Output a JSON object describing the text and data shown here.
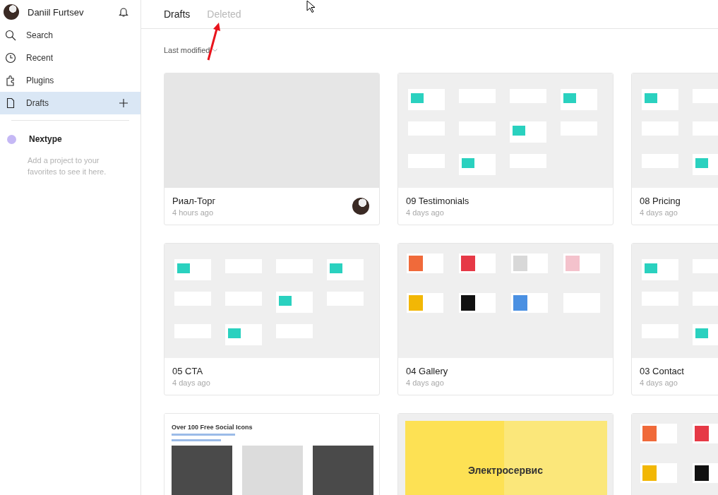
{
  "sidebar": {
    "user": {
      "name": "Daniil Furtsev"
    },
    "nav": [
      {
        "kind": "search",
        "label": "Search",
        "selected": false
      },
      {
        "kind": "recent",
        "label": "Recent",
        "selected": false
      },
      {
        "kind": "plugins",
        "label": "Plugins",
        "selected": false
      },
      {
        "kind": "drafts",
        "label": "Drafts",
        "selected": true
      }
    ],
    "teams": [
      {
        "name": "Nextype",
        "color": "#c5b8f5"
      }
    ],
    "favorites_hint": "Add a project to your favorites to see it here."
  },
  "tabs": [
    {
      "label": "Drafts",
      "selected": true
    },
    {
      "label": "Deleted",
      "selected": false
    }
  ],
  "sort": {
    "label": "Last modified"
  },
  "files": [
    {
      "kind": "blank",
      "title": "Риал-Торг",
      "modified": "4 hours ago",
      "owner_avatar": true
    },
    {
      "kind": "frames",
      "title": "09 Testimonials",
      "modified": "4 days ago"
    },
    {
      "kind": "frames",
      "title": "08 Pricing",
      "modified": "4 days ago"
    },
    {
      "kind": "frames",
      "title": "05 CTA",
      "modified": "4 days ago"
    },
    {
      "kind": "gallery",
      "title": "04 Gallery",
      "modified": "4 days ago"
    },
    {
      "kind": "frames",
      "title": "03 Contact",
      "modified": "4 days ago"
    },
    {
      "kind": "social",
      "caption": "Over 100 Free Social Icons"
    },
    {
      "kind": "banner",
      "caption": "Электросервис"
    },
    {
      "kind": "gallery"
    }
  ]
}
